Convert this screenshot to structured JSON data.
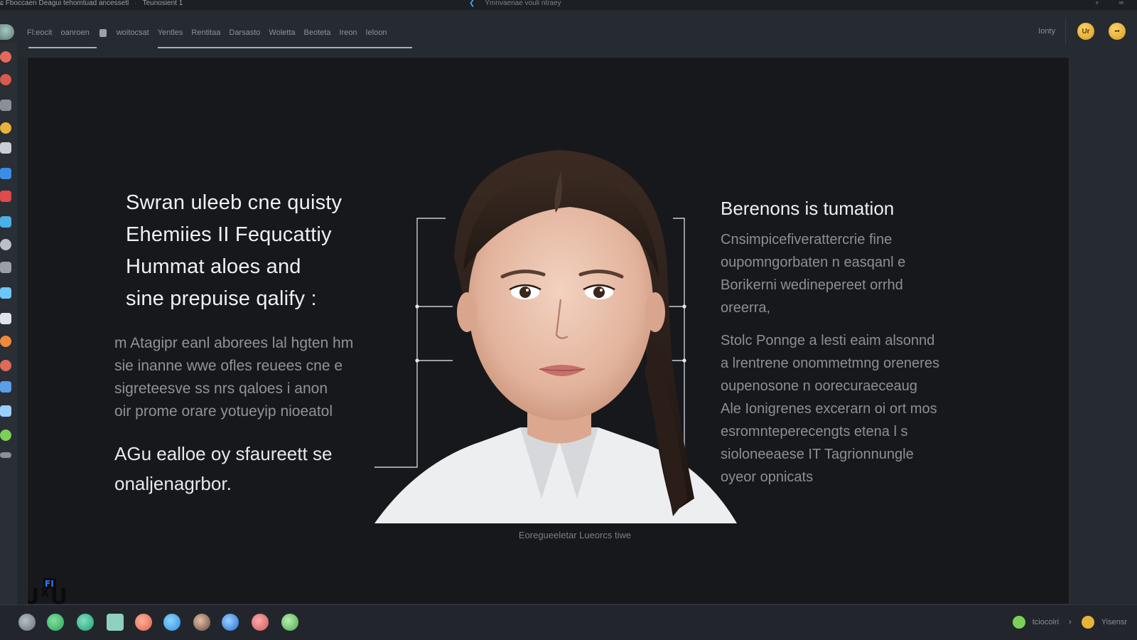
{
  "window": {
    "title_left": "ɕ Fboccaen Deagui tehomtuad ancessetl",
    "title_left_b": "Teunosient 1",
    "title_center": "Ymnvaenae vouli ntraey",
    "title_right_a": "∘",
    "title_right_b": "⋍"
  },
  "toolbar": {
    "tabs": [
      "Fl:eocit",
      "oanroen",
      "woitocsat",
      "Yentles",
      "Rentitaa",
      "Darsasto",
      "Woletta",
      "Beoteta",
      "Ireon",
      "Ieloon"
    ],
    "right_text": "Ionty",
    "coin1_label": "Ur",
    "coin2_label": "••"
  },
  "slide": {
    "headline_lines": [
      "Swran uleeb cne quisty",
      "Ehemiies II Fequcattiy",
      "Hummat aloes and",
      "sine prepuise qalify :"
    ],
    "left_body_lines": [
      "m Atagipr eanl aborees lal hgten hm",
      "sie inanne wwe ofles reuees cne e",
      "sigreteesve ss nrs qaloes i anon",
      "oir prome orare yotueyip nioeatol"
    ],
    "left_foot_lines": [
      "AGu ealloe oy sfaureett se",
      "onaljenagrbor."
    ],
    "right_heading": "Berenons is tumation",
    "right_para1_lines": [
      "Cnsimpicefiverattercrie fine",
      "oupomngorbaten n easqanl e",
      "Borikerni wedinepereet orrhd",
      "oreerra,"
    ],
    "right_para2_lines": [
      "Stolc Ponnge a lesti eaim alsonnd",
      "a lrentrene onommetmng oreneres",
      "oupenosone n oorecuraeceaug",
      "Ale Ionigrenes excerarn oi ort mos",
      "esromnteperecengts etena l s",
      "sioloneeaese IT Tagrionnungle",
      "oyeor opnicats"
    ],
    "caption": "Eoregueeletar   Lueorcs tiwe"
  },
  "watermark_text": "ᑌᕽᑌ",
  "watermark_badge": "FI",
  "taskbar": {
    "right_label": "tciocoiri",
    "right_clock": "Yisensr",
    "arrow": "›"
  },
  "colors": {
    "panel_bg": "#17181b",
    "app_bg": "#23272e",
    "accent_coin": "#e8b33a",
    "tray_green": "#7ccf57"
  }
}
